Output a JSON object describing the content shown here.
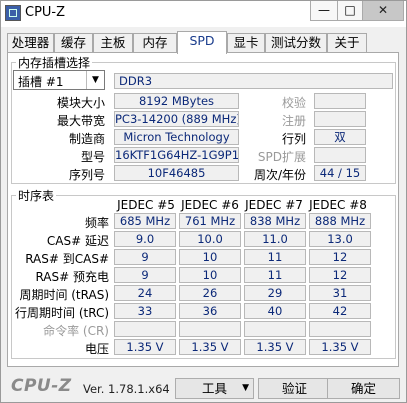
{
  "window": {
    "title": "CPU-Z",
    "min_label": "—",
    "max_label": "□",
    "close_label": "✕"
  },
  "tabs": [
    {
      "label": "处理器"
    },
    {
      "label": "缓存"
    },
    {
      "label": "主板"
    },
    {
      "label": "内存"
    },
    {
      "label": "SPD",
      "active": true
    },
    {
      "label": "显卡"
    },
    {
      "label": "测试分数"
    },
    {
      "label": "关于"
    }
  ],
  "slot_group": {
    "legend": "内存插槽选择",
    "slot_value": "插槽 #1",
    "type": "DDR3",
    "module_size_label": "模块大小",
    "module_size": "8192 MBytes",
    "max_bandwidth_label": "最大带宽",
    "max_bandwidth": "PC3-14200 (889 MHz)",
    "manufacturer_label": "制造商",
    "manufacturer": "Micron Technology",
    "part_label": "型号",
    "part_number": "16KTF1G64HZ-1G9P1",
    "serial_label": "序列号",
    "serial": "10F46485",
    "correction_label": "校验",
    "correction": "",
    "registered_label": "注册",
    "registered": "",
    "ranks_label": "行列",
    "ranks": "双",
    "spd_ext_label": "SPD扩展",
    "spd_ext": "",
    "week_year_label": "周次/年份",
    "week_year": "44 / 15"
  },
  "timing_group": {
    "legend": "时序表",
    "columns": [
      "JEDEC #5",
      "JEDEC #6",
      "JEDEC #7",
      "JEDEC #8"
    ],
    "rows": [
      {
        "label": "频率",
        "values": [
          "685 MHz",
          "761 MHz",
          "838 MHz",
          "888 MHz"
        ]
      },
      {
        "label": "CAS# 延迟",
        "values": [
          "9.0",
          "10.0",
          "11.0",
          "13.0"
        ]
      },
      {
        "label": "RAS# 到CAS#",
        "values": [
          "9",
          "10",
          "11",
          "12"
        ]
      },
      {
        "label": "RAS# 预充电",
        "values": [
          "9",
          "10",
          "11",
          "12"
        ]
      },
      {
        "label": "周期时间 (tRAS)",
        "values": [
          "24",
          "26",
          "29",
          "31"
        ]
      },
      {
        "label": "行周期时间 (tRC)",
        "values": [
          "33",
          "36",
          "40",
          "42"
        ]
      },
      {
        "label": "命令率 (CR)",
        "values": [
          "",
          "",
          "",
          ""
        ],
        "dim": true
      },
      {
        "label": "电压",
        "values": [
          "1.35 V",
          "1.35 V",
          "1.35 V",
          "1.35 V"
        ]
      }
    ]
  },
  "footer": {
    "logo": "CPU-Z",
    "version": "Ver. 1.78.1.x64",
    "tools_label": "工具",
    "validate_label": "验证",
    "ok_label": "确定"
  }
}
